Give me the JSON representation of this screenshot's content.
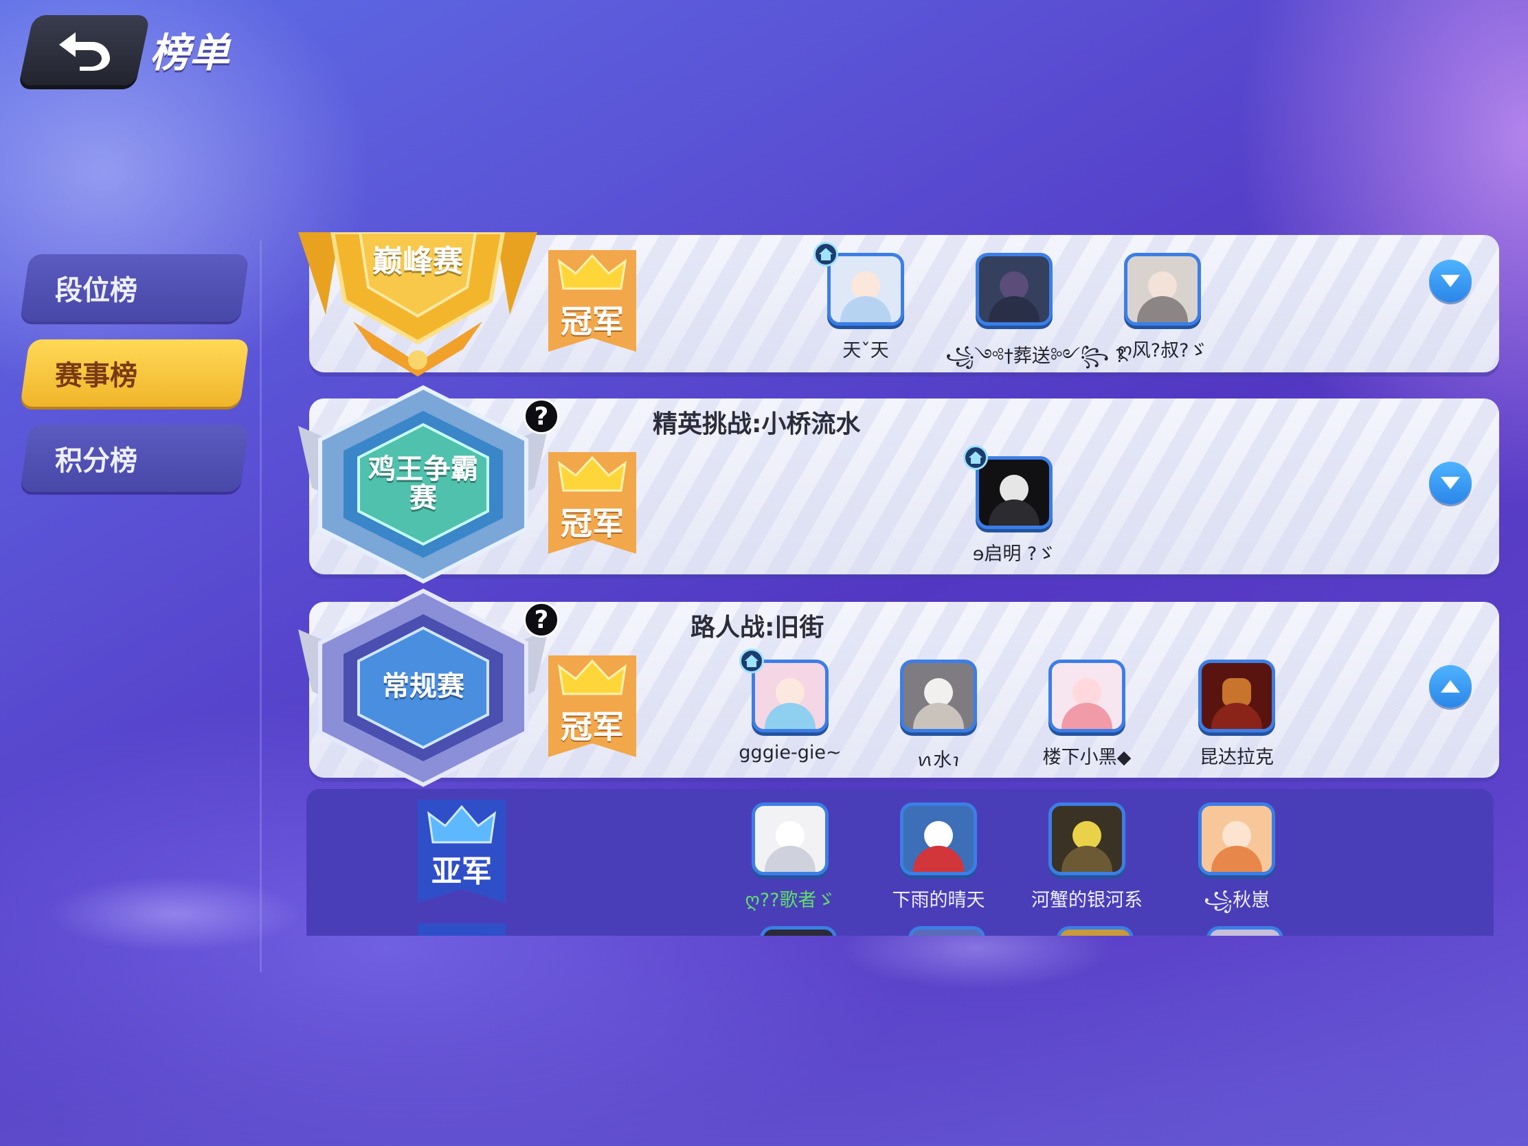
{
  "header": {
    "title": "榜单"
  },
  "sidebar": {
    "items": [
      {
        "label": "段位榜",
        "active": false
      },
      {
        "label": "赛事榜",
        "active": true
      },
      {
        "label": "积分榜",
        "active": false
      }
    ]
  },
  "colors": {
    "accent_gold": "#f0b52a",
    "accent_blue": "#3c7ee6",
    "ribbon_orange": "#f2a74a",
    "panel_purple": "#4a3eb8"
  },
  "events": [
    {
      "badge": "巅峰赛",
      "badge_color": "gold",
      "title": "",
      "rank_label": "冠军",
      "expanded": false,
      "players": [
        {
          "name": "天ˇ天",
          "home": true
        },
        {
          "name": "꧁༺†葬送༻꧂ ?",
          "home": false
        },
        {
          "name": "ღ风?叔?ゞ",
          "home": false
        }
      ]
    },
    {
      "badge": "鸡王争霸赛",
      "badge_color": "teal",
      "title": "精英挑战:小桥流水",
      "rank_label": "冠军",
      "expanded": false,
      "players": [
        {
          "name": "ɘ启明 ?ゞ",
          "home": true
        }
      ]
    },
    {
      "badge": "常规赛",
      "badge_color": "blue",
      "title": "路人战:旧街",
      "rank_label": "冠军",
      "expanded": true,
      "players": [
        {
          "name": "gggie-gie~",
          "home": true
        },
        {
          "name": "ꪕ水ꪱ",
          "home": false
        },
        {
          "name": "楼下小黑◆",
          "home": false
        },
        {
          "name": "昆达拉克",
          "home": false
        }
      ]
    }
  ],
  "runner_up": {
    "rank_label": "亚军",
    "players": [
      {
        "name": "ღ??歌者ゞ"
      },
      {
        "name": "下雨的晴天"
      },
      {
        "name": "河蟹的银河系"
      },
      {
        "name": "꧁秋崽"
      }
    ]
  },
  "help_symbol": "?"
}
